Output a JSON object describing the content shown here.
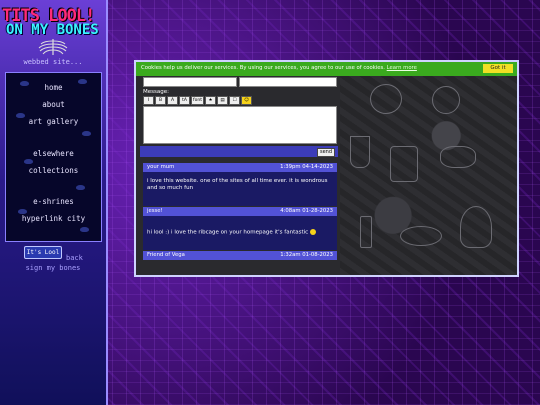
{
  "site": {
    "logo_line1": "TITS LOOL!",
    "logo_line2": "ON MY BONES",
    "tagline": "webbed site..."
  },
  "nav": [
    "home",
    "about",
    "art gallery",
    "elsewhere",
    "collections",
    "e-shrines",
    "hyperlink city"
  ],
  "footer": {
    "badge": "It's Lool",
    "back": "back",
    "sign": "sign my bones"
  },
  "cookie": {
    "message": "Cookies help us deliver our services. By using our services, you agree to our use of cookies.",
    "learn_more": "Learn more",
    "got_it": "Got it"
  },
  "form": {
    "message_label": "Message:",
    "toolbar": [
      "I",
      "B",
      "A",
      "tA",
      "font",
      "★",
      "▤",
      "☐",
      "☺"
    ],
    "send_label": "send"
  },
  "entries": [
    {
      "name": "your mum",
      "date": "1:39pm 04-14-2023",
      "text": "i love this website. one of the sites of all time ever. it is wondrous and so much fun"
    },
    {
      "name": "jesse!",
      "date": "4:08am 01-28-2023",
      "text": "hi lool :) i love the ribcage on your homepage it's fantastic"
    },
    {
      "name": "Friend of Vega",
      "date": "1:32am 01-08-2023",
      "text": ""
    }
  ],
  "colors": {
    "accent": "#5252d6",
    "cookie_bg": "#3aaa1e",
    "got_it": "#f0e024"
  }
}
